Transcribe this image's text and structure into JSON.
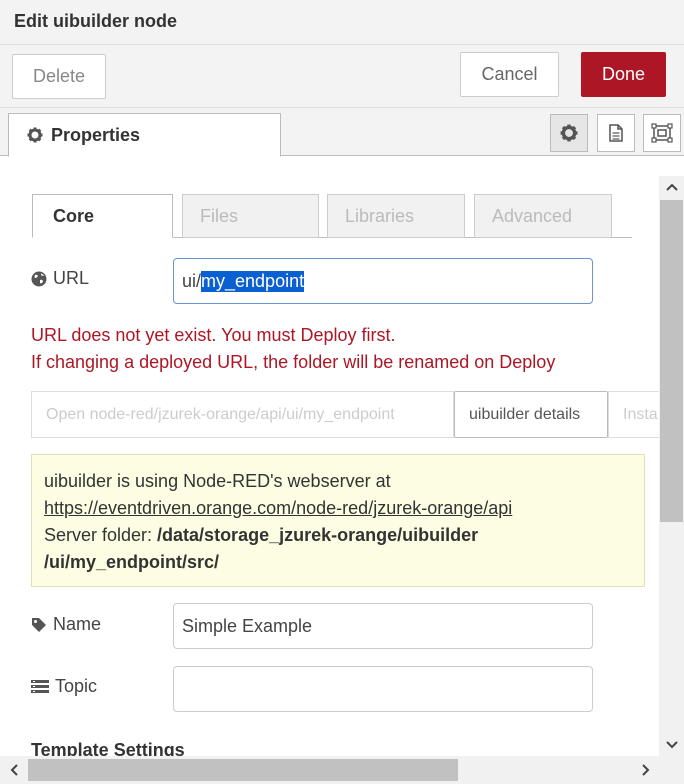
{
  "dialog": {
    "title": "Edit uibuilder node"
  },
  "buttons": {
    "delete": "Delete",
    "cancel": "Cancel",
    "done": "Done"
  },
  "tabs": {
    "properties": "Properties",
    "icons": [
      "gear-icon",
      "document-icon",
      "frame-icon"
    ]
  },
  "subtabs": [
    "Core",
    "Files",
    "Libraries",
    "Advanced"
  ],
  "url": {
    "label": "URL",
    "prefix": "ui/",
    "value": "my_endpoint",
    "error_line1": "URL does not yet exist. You must Deploy first.",
    "error_line2": "If changing a deployed URL, the folder will be renamed on Deploy"
  },
  "link_buttons": {
    "open": "Open node-red/jzurek-orange/api/ui/my_endpoint",
    "details": "uibuilder details",
    "install": "Insta"
  },
  "info": {
    "line1": "uibuilder is using Node-RED's webserver at",
    "link": "https://eventdriven.orange.com/node-red/jzurek-orange/api",
    "server_label": "Server folder: ",
    "server_path1": "/data/storage_jzurek-orange/uibuilder",
    "server_path2": "/ui/my_endpoint/src/"
  },
  "name": {
    "label": "Name",
    "value": "Simple Example"
  },
  "topic": {
    "label": "Topic",
    "value": ""
  },
  "section": {
    "template_settings": "Template Settings"
  },
  "colors": {
    "done": "#ad1625",
    "error": "#ad1625",
    "selection": "#0a5fd1",
    "info_bg": "#fdfde4"
  }
}
